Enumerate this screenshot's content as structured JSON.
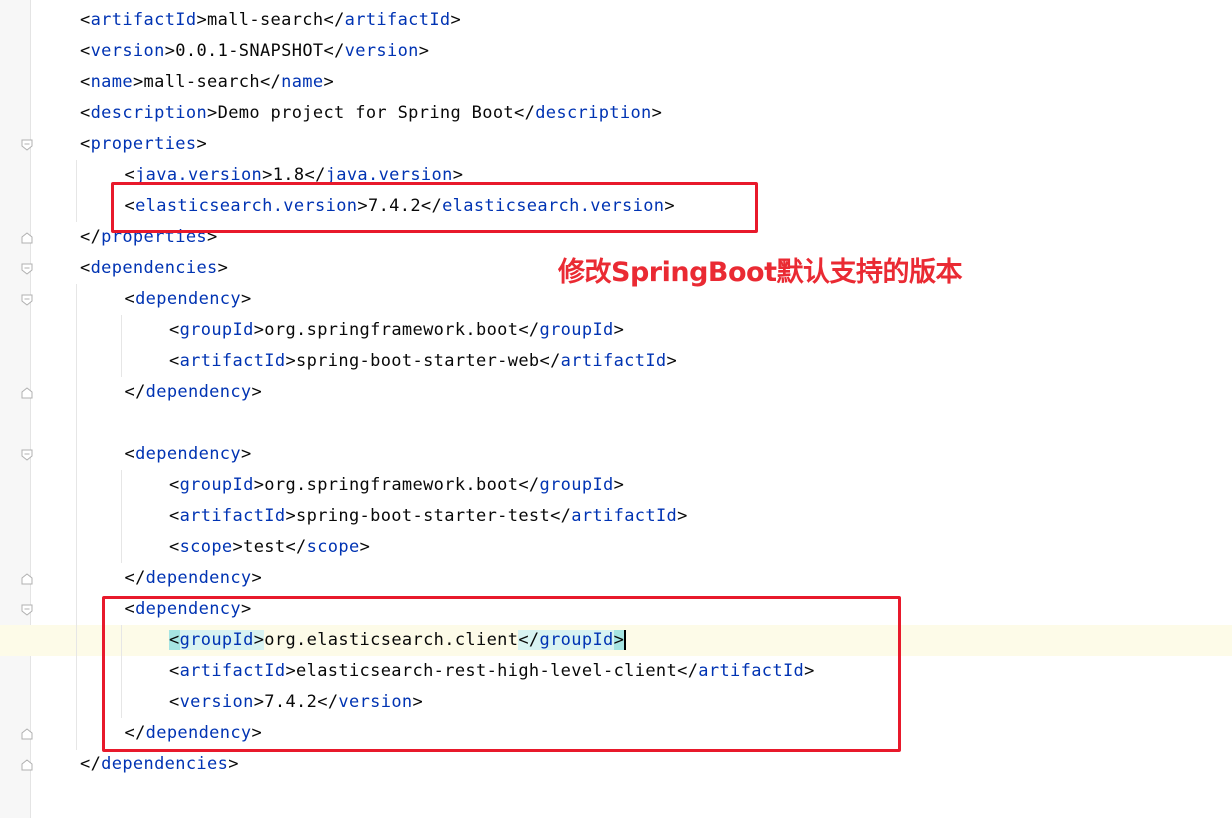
{
  "editor": {
    "lines": [
      {
        "t": "open-close",
        "tag": "artifactId",
        "text": "mall-search"
      },
      {
        "t": "open-close",
        "tag": "version",
        "text": "0.0.1-SNAPSHOT"
      },
      {
        "t": "open-close",
        "tag": "name",
        "text": "mall-search"
      },
      {
        "t": "open-close",
        "tag": "description",
        "text": "Demo project for Spring Boot"
      },
      {
        "t": "open",
        "tag": "properties"
      },
      {
        "t": "open-close",
        "tag": "java.version",
        "text": "1.8"
      },
      {
        "t": "open-close",
        "tag": "elasticsearch.version",
        "text": "7.4.2"
      },
      {
        "t": "close",
        "tag": "properties"
      },
      {
        "t": "open",
        "tag": "dependencies"
      },
      {
        "t": "open",
        "tag": "dependency"
      },
      {
        "t": "open-close",
        "tag": "groupId",
        "text": "org.springframework.boot"
      },
      {
        "t": "open-close",
        "tag": "artifactId",
        "text": "spring-boot-starter-web"
      },
      {
        "t": "close",
        "tag": "dependency"
      },
      {
        "t": "blank"
      },
      {
        "t": "open",
        "tag": "dependency"
      },
      {
        "t": "open-close",
        "tag": "groupId",
        "text": "org.springframework.boot"
      },
      {
        "t": "open-close",
        "tag": "artifactId",
        "text": "spring-boot-starter-test"
      },
      {
        "t": "open-close",
        "tag": "scope",
        "text": "test"
      },
      {
        "t": "close",
        "tag": "dependency"
      },
      {
        "t": "open",
        "tag": "dependency"
      },
      {
        "t": "open-close",
        "tag": "groupId",
        "text": "org.elasticsearch.client",
        "active": true
      },
      {
        "t": "open-close",
        "tag": "artifactId",
        "text": "elasticsearch-rest-high-level-client"
      },
      {
        "t": "open-close",
        "tag": "version",
        "text": "7.4.2"
      },
      {
        "t": "close",
        "tag": "dependency"
      },
      {
        "t": "close",
        "tag": "dependencies"
      }
    ]
  },
  "annotation": {
    "note": "修改SpringBoot默认支持的版本"
  },
  "colors": {
    "tag": "#0033b3",
    "text": "#080808",
    "highlight_box": "#e8192b",
    "note_text": "#ea2a33",
    "tag_match": "#a6e5e3"
  }
}
